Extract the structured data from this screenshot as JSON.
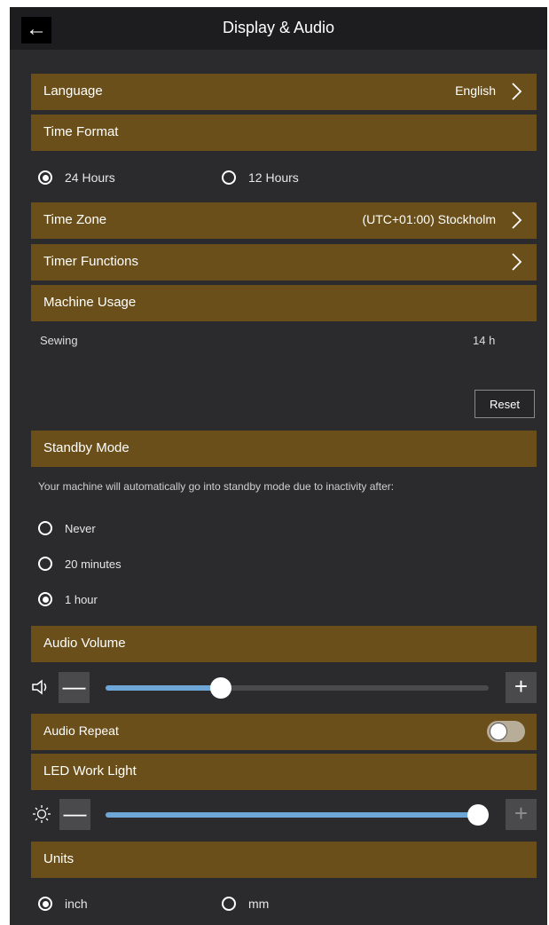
{
  "header": {
    "title": "Display & Audio",
    "back_icon": "arrow-left-icon"
  },
  "language": {
    "label": "Language",
    "value": "English"
  },
  "time_format": {
    "label": "Time Format",
    "options": [
      {
        "label": "24 Hours",
        "selected": true
      },
      {
        "label": "12 Hours",
        "selected": false
      }
    ]
  },
  "time_zone": {
    "label": "Time Zone",
    "value": "(UTC+01:00) Stockholm"
  },
  "timer_functions": {
    "label": "Timer Functions"
  },
  "machine_usage": {
    "label": "Machine Usage",
    "item_label": "Sewing",
    "item_value": "14 h",
    "reset_label": "Reset"
  },
  "standby": {
    "label": "Standby Mode",
    "description": "Your machine will automatically go into standby mode due to inactivity after:",
    "options": [
      {
        "label": "Never",
        "selected": false
      },
      {
        "label": "20 minutes",
        "selected": false
      },
      {
        "label": "1 hour",
        "selected": true
      }
    ]
  },
  "audio_volume": {
    "label": "Audio Volume",
    "level_percent": 30
  },
  "audio_repeat": {
    "label": "Audio Repeat",
    "enabled": false
  },
  "led_work_light": {
    "label": "LED Work Light",
    "level_percent": 100
  },
  "units": {
    "label": "Units",
    "options": [
      {
        "label": "inch",
        "selected": true
      },
      {
        "label": "mm",
        "selected": false
      }
    ]
  },
  "colors": {
    "section_bar": "#6a4f1a",
    "background": "#2b2b2e",
    "slider_fill": "#6fa6d8"
  }
}
